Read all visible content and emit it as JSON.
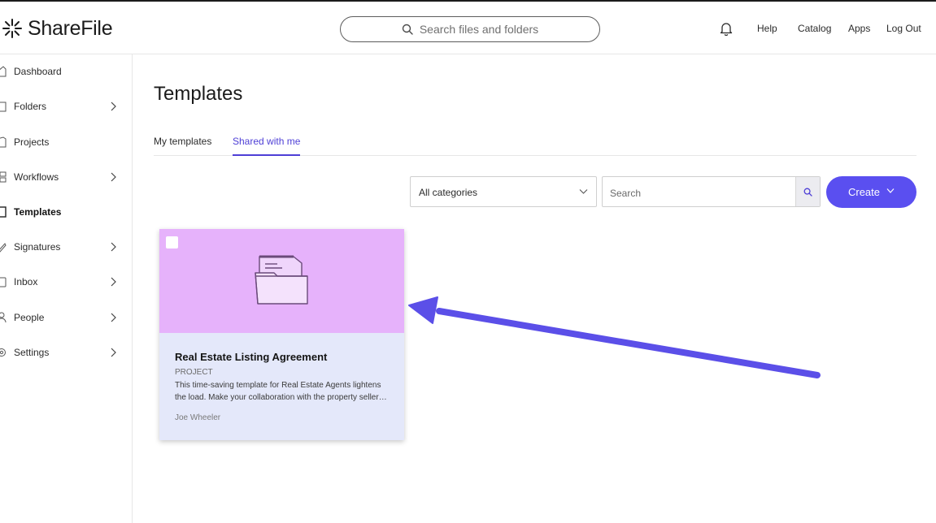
{
  "app": {
    "logo_text": "ShareFile"
  },
  "header": {
    "search_placeholder": "Search files and folders",
    "links": [
      "Help",
      "Catalog",
      "Apps",
      "Log Out"
    ]
  },
  "sidebar": {
    "items": [
      {
        "label": "Dashboard",
        "icon": "home-icon",
        "expandable": false,
        "active": false
      },
      {
        "label": "Folders",
        "icon": "folder-icon",
        "expandable": true,
        "active": false
      },
      {
        "label": "Projects",
        "icon": "projects-icon",
        "expandable": false,
        "active": false
      },
      {
        "label": "Workflows",
        "icon": "workflow-icon",
        "expandable": true,
        "active": false
      },
      {
        "label": "Templates",
        "icon": "template-icon",
        "expandable": false,
        "active": true
      },
      {
        "label": "Signatures",
        "icon": "pen-icon",
        "expandable": true,
        "active": false
      },
      {
        "label": "Inbox",
        "icon": "inbox-icon",
        "expandable": true,
        "active": false
      },
      {
        "label": "People",
        "icon": "people-icon",
        "expandable": true,
        "active": false
      },
      {
        "label": "Settings",
        "icon": "gear-icon",
        "expandable": true,
        "active": false
      }
    ]
  },
  "main": {
    "title": "Templates",
    "tabs": [
      {
        "label": "My templates",
        "active": false
      },
      {
        "label": "Shared with me",
        "active": true
      }
    ],
    "category_select": {
      "value": "All categories"
    },
    "search": {
      "placeholder": "Search"
    },
    "create_label": "Create",
    "cards": [
      {
        "title": "Real Estate Listing Agreement",
        "type": "PROJECT",
        "description": "This time-saving template for Real Estate Agents lightens the load. Make your collaboration with the property seller…",
        "owner": "Joe Wheeler"
      }
    ]
  },
  "colors": {
    "accent": "#5a4ff0",
    "tab_active": "#4e3fd6",
    "card_header": "#e6b2fb",
    "card_body": "#e4e8fa",
    "annotation_arrow": "#5b4fe8"
  }
}
